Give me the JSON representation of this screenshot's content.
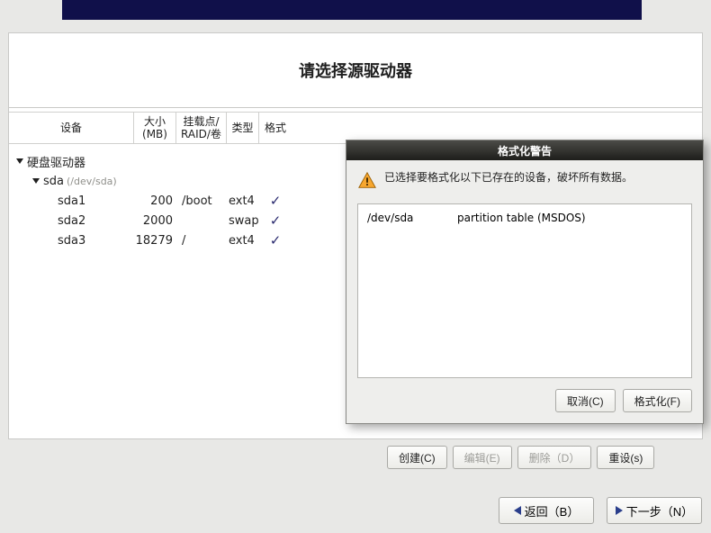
{
  "title": "请选择源驱动器",
  "columns": {
    "device": "设备",
    "size": "大小\n(MB)",
    "mount": "挂载点/\nRAID/卷",
    "type": "类型",
    "format": "格式"
  },
  "tree": {
    "rootName": "硬盘驱动器",
    "disk": {
      "name": "sda",
      "path": "(/dev/sda)"
    },
    "partitions": [
      {
        "name": "sda1",
        "size": "200",
        "mount": "/boot",
        "type": "ext4",
        "fmt": true
      },
      {
        "name": "sda2",
        "size": "2000",
        "mount": "",
        "type": "swap",
        "fmt": true
      },
      {
        "name": "sda3",
        "size": "18279",
        "mount": "/",
        "type": "ext4",
        "fmt": true
      }
    ]
  },
  "buttons": {
    "create": "创建(C)",
    "edit": "编辑(E)",
    "delete": "删除（D）",
    "reset": "重设(s)",
    "back": "返回（B）",
    "next": "下一步（N）"
  },
  "dialog": {
    "title": "格式化警告",
    "message": "已选择要格式化以下已存在的设备，破坏所有数据。",
    "items": [
      {
        "device": "/dev/sda",
        "desc": "partition table (MSDOS)"
      }
    ],
    "cancel": "取消(C)",
    "format": "格式化(F)"
  }
}
